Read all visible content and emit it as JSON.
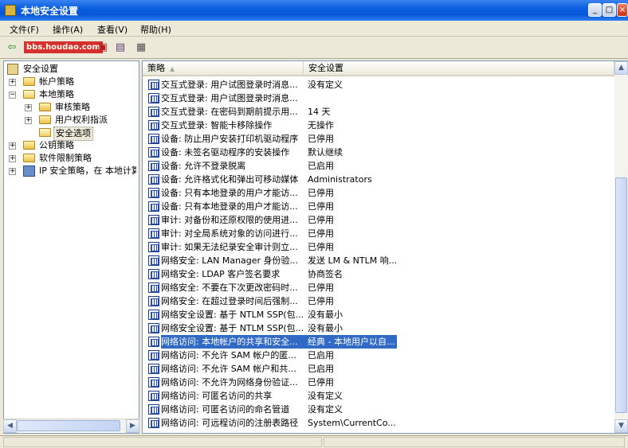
{
  "window": {
    "title": "本地安全设置"
  },
  "menu": [
    "文件(F)",
    "操作(A)",
    "查看(V)",
    "帮助(H)"
  ],
  "toolbar": {
    "watermark": "bbs.houdao.com"
  },
  "tree": [
    {
      "label": "安全设置"
    },
    {
      "label": "帐户策略",
      "expander": "+"
    },
    {
      "label": "本地策略",
      "expander": "−"
    },
    {
      "label": "审核策略",
      "expander": "+"
    },
    {
      "label": "用户权利指派",
      "expander": "+"
    },
    {
      "label": "安全选项"
    },
    {
      "label": "公钥策略",
      "expander": "+"
    },
    {
      "label": "软件限制策略",
      "expander": "+"
    },
    {
      "label": "IP 安全策略，在 本地计算机"
    }
  ],
  "list": {
    "columns": {
      "policy": "策略",
      "setting": "安全设置"
    },
    "rows": [
      {
        "policy": "交互式登录: 用户试图登录时消息标题",
        "setting": "没有定义"
      },
      {
        "policy": "交互式登录: 用户试图登录时消息文字",
        "setting": ""
      },
      {
        "policy": "交互式登录: 在密码到期前提示用户更改密码",
        "setting": "14 天"
      },
      {
        "policy": "交互式登录: 智能卡移除操作",
        "setting": "无操作"
      },
      {
        "policy": "设备: 防止用户安装打印机驱动程序",
        "setting": "已停用"
      },
      {
        "policy": "设备: 未签名驱动程序的安装操作",
        "setting": "默认继续"
      },
      {
        "policy": "设备: 允许不登录脱离",
        "setting": "已启用"
      },
      {
        "policy": "设备: 允许格式化和弹出可移动媒体",
        "setting": "Administrators"
      },
      {
        "policy": "设备: 只有本地登录的用户才能访问 CD-ROM",
        "setting": "已停用"
      },
      {
        "policy": "设备: 只有本地登录的用户才能访问软盘",
        "setting": "已停用"
      },
      {
        "policy": "审计: 对备份和还原权限的使用进行审计",
        "setting": "已停用"
      },
      {
        "policy": "审计: 对全局系统对象的访问进行审计",
        "setting": "已停用"
      },
      {
        "policy": "审计: 如果无法纪录安全审计则立即关闭系统",
        "setting": "已停用"
      },
      {
        "policy": "网络安全: LAN Manager 身份验证级别",
        "setting": "发送 LM & NTLM 响应"
      },
      {
        "policy": "网络安全: LDAP 客户签名要求",
        "setting": "协商签名"
      },
      {
        "policy": "网络安全: 不要在下次更改密码时存储 LAN Manager 的哈希值",
        "setting": "已停用"
      },
      {
        "policy": "网络安全: 在超过登录时间后强制注销",
        "setting": "已停用"
      },
      {
        "policy": "网络安全设置: 基于 NTLM SSP(包括安全 RPC)客户的最小会话安全",
        "setting": "没有最小"
      },
      {
        "policy": "网络安全设置: 基于 NTLM SSP(包括安全 RPC)服务器的最小会话安全",
        "setting": "没有最小"
      },
      {
        "policy": "网络访问: 本地帐户的共享和安全模式",
        "setting": "经典 - 本地用户以自己的身份验证",
        "selected": true
      },
      {
        "policy": "网络访问: 不允许 SAM 帐户的匿名枚举",
        "setting": "已启用"
      },
      {
        "policy": "网络访问: 不允许 SAM 帐户和共享的匿名枚举",
        "setting": "已启用"
      },
      {
        "policy": "网络访问: 不允许为网络身份验证储存凭据或 .NET Passports",
        "setting": "已停用"
      },
      {
        "policy": "网络访问: 可匿名访问的共享",
        "setting": "没有定义"
      },
      {
        "policy": "网络访问: 可匿名访问的命名管道",
        "setting": "没有定义"
      },
      {
        "policy": "网络访问: 可远程访问的注册表路径",
        "setting": "System\\CurrentControlSet\\Control"
      }
    ]
  }
}
